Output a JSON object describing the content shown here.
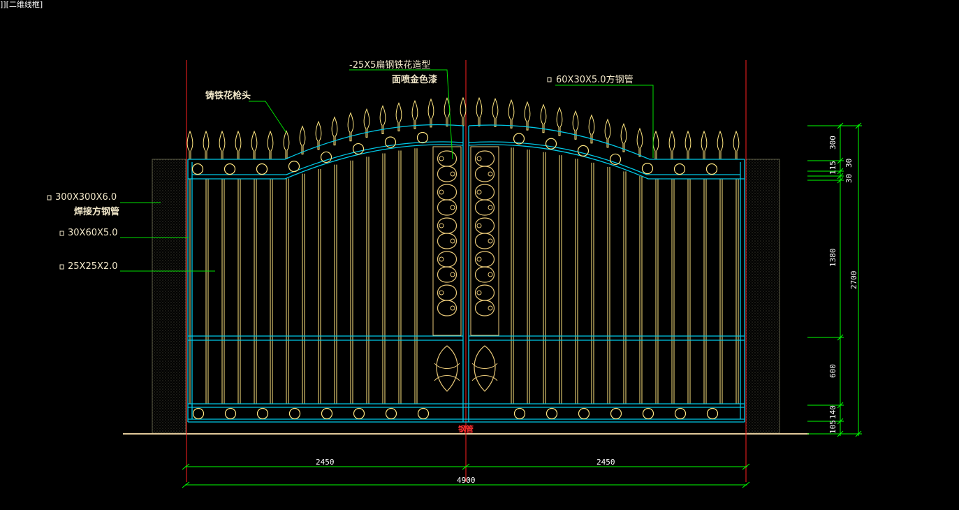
{
  "viewport_label": "]][二维线框]",
  "colors": {
    "background": "#000000",
    "frame": "#00c8e6",
    "bars": "#ffe680",
    "ornament": "#e8c878",
    "leader": "#00e000",
    "dimension": "#00ff00",
    "centerline": "#ff2020",
    "pillar": "#3a3a2a",
    "ground": "#e0c89a"
  },
  "annotations": {
    "spear_head": "铸铁花枪头",
    "flat_steel_line1": "-25X5扁钢铁花造型",
    "flat_steel_line2": "面喷金色漆",
    "top_tube": "60X30X5.0方钢管",
    "post_line1": "300X300X6.0",
    "post_line2": "焊接方钢管",
    "frame_tube": "30X60X5.0",
    "bar_tube": "25X25X2.0",
    "hinge": "钢管"
  },
  "dimensions": {
    "left_width": "2450",
    "right_width": "2450",
    "total_width": "4900",
    "d300": "300",
    "d115": "115",
    "d30a": "30",
    "d30b": "30",
    "d1380": "1380",
    "d600": "600",
    "d140": "140",
    "d105": "105",
    "total_height": "2700"
  }
}
